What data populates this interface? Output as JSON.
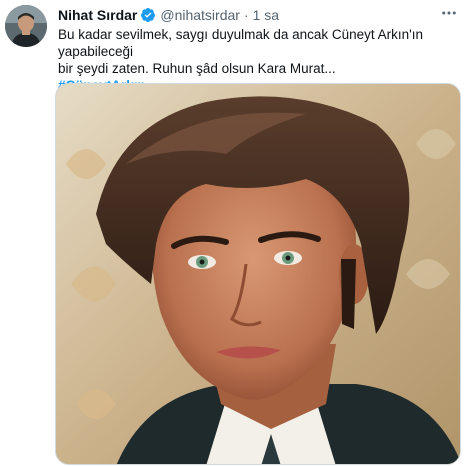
{
  "tweet": {
    "author": {
      "display_name": "Nihat Sırdar",
      "handle": "@nihatsirdar",
      "verified": true
    },
    "separator": "·",
    "time": "1 sa",
    "text_line1": "Bu kadar sevilmek, saygı duyulmak da ancak Cüneyt Arkın'ın yapabileceği",
    "text_line2": "bir şeydi zaten. Ruhun şâd olsun Kara Murat...",
    "hashtag": "#CüneytArkın",
    "media": {
      "description_icon": "portrait-photo"
    }
  },
  "colors": {
    "accent": "#1d9bf0",
    "text": "#0f1419",
    "secondary": "#536471"
  },
  "icons": {
    "verified": "verified-badge-icon",
    "more": "more-options-icon"
  }
}
